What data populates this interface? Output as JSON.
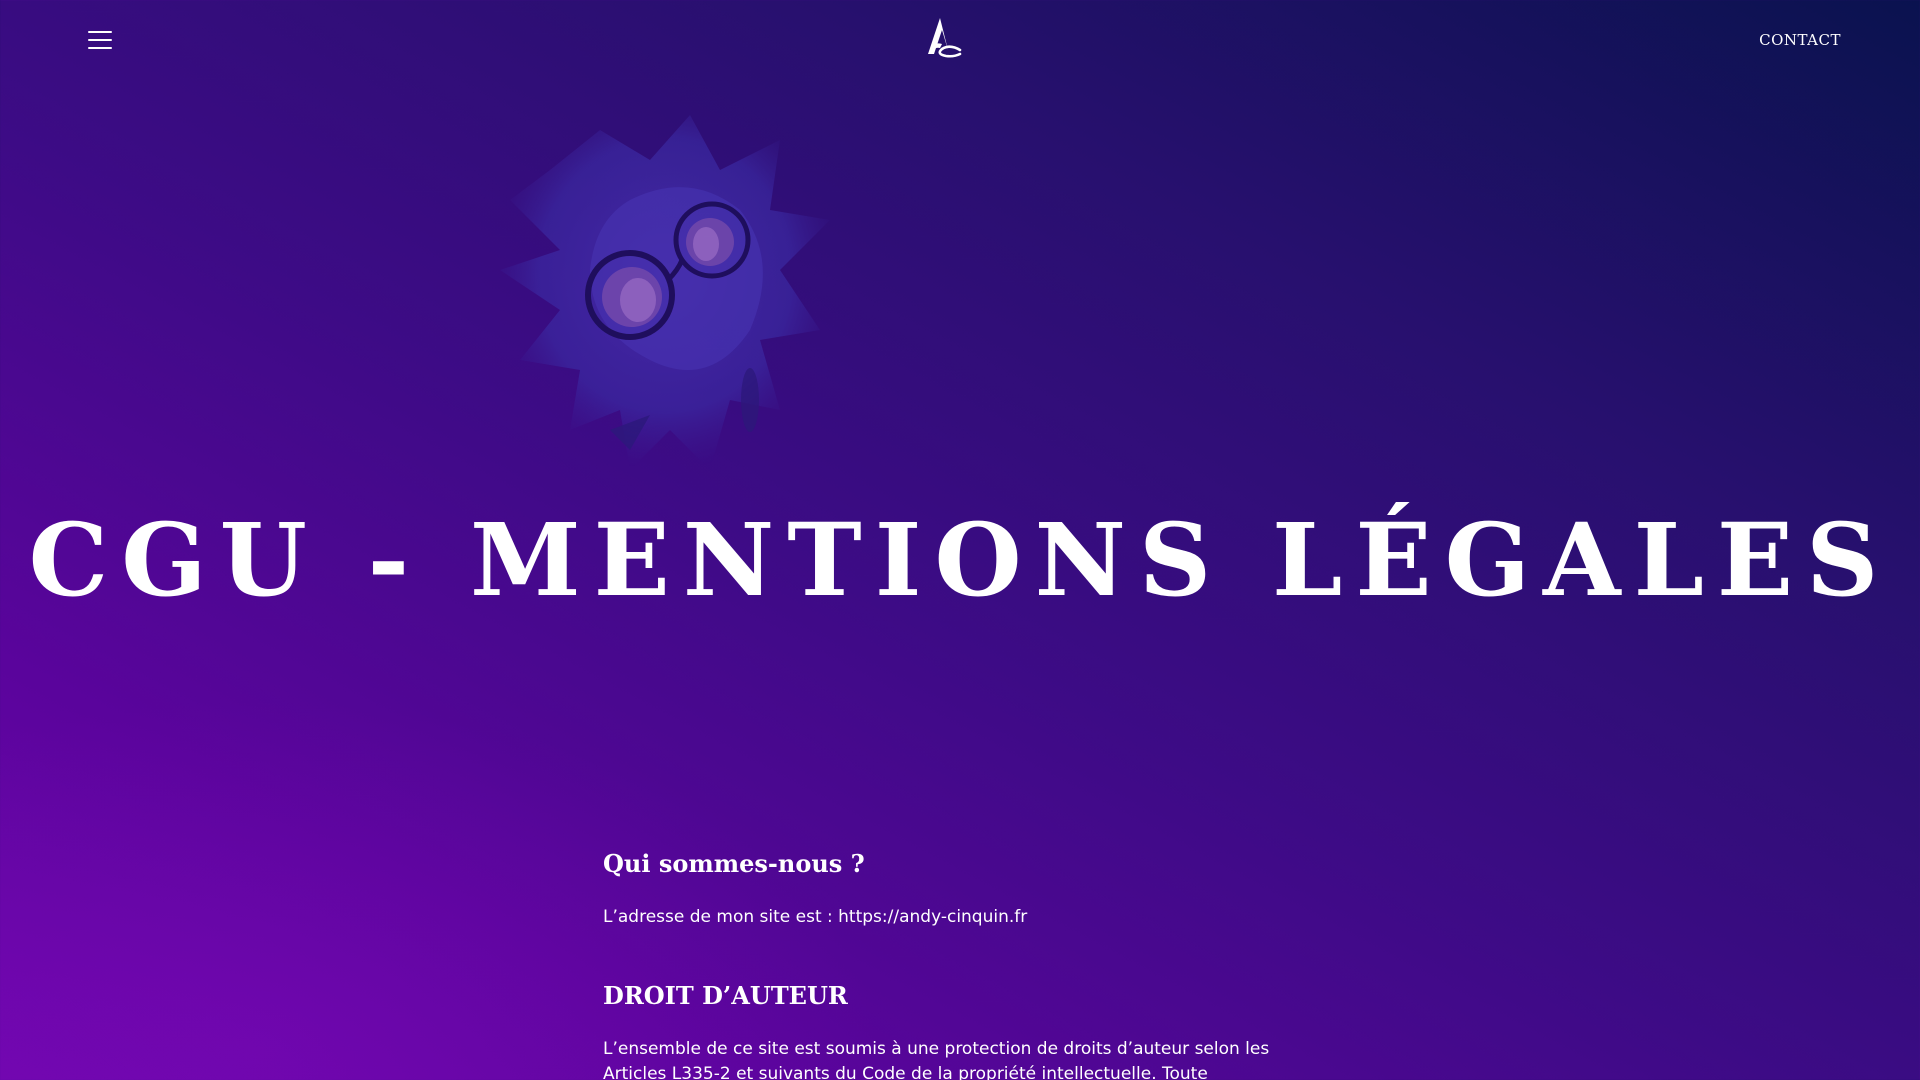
{
  "header": {
    "menu_icon": "hamburger-menu-icon",
    "logo_icon": "ac-monogram-logo",
    "contact_label": "CONTACT"
  },
  "hero": {
    "illustration": "owl-with-glasses-illustration",
    "title": "CGU - MENTIONS LÉGALES"
  },
  "content": {
    "sections": [
      {
        "heading": "Qui sommes-nous ?",
        "text": "L’adresse de mon site est : https://andy-cinquin.fr"
      },
      {
        "heading": "DROIT D’AUTEUR",
        "text": "L’ensemble de ce site est soumis à une protection de droits d’auteur selon les Articles L335-2 et suivants du Code de la propriété intellectuelle. Toute reproduction ou"
      }
    ]
  },
  "colors": {
    "background_top_right": "#0a124f",
    "background_bottom_left": "#6e06ad",
    "text": "#ffffff"
  }
}
